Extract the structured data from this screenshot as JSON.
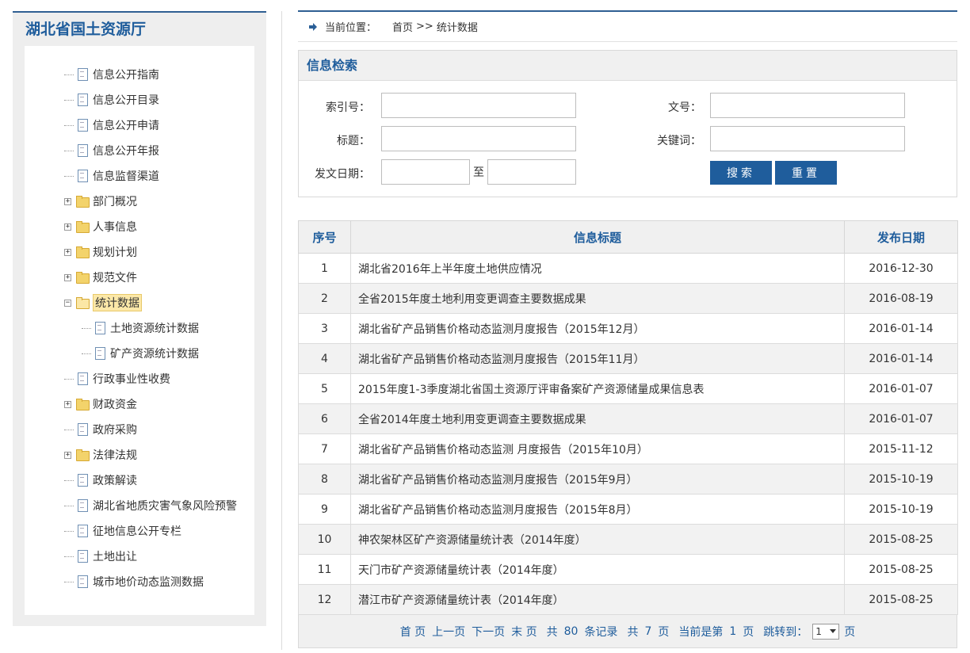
{
  "sidebar": {
    "title": "湖北省国土资源厅",
    "items": [
      {
        "label": "信息公开指南",
        "type": "doc"
      },
      {
        "label": "信息公开目录",
        "type": "doc"
      },
      {
        "label": "信息公开申请",
        "type": "doc"
      },
      {
        "label": "信息公开年报",
        "type": "doc"
      },
      {
        "label": "信息监督渠道",
        "type": "doc"
      },
      {
        "label": "部门概况",
        "type": "folder",
        "toggle": "+"
      },
      {
        "label": "人事信息",
        "type": "folder",
        "toggle": "+"
      },
      {
        "label": "规划计划",
        "type": "folder",
        "toggle": "+"
      },
      {
        "label": "规范文件",
        "type": "folder",
        "toggle": "+"
      },
      {
        "label": "统计数据",
        "type": "folder-open",
        "toggle": "−",
        "active": true
      },
      {
        "label": "土地资源统计数据",
        "type": "doc",
        "child": true
      },
      {
        "label": "矿产资源统计数据",
        "type": "doc",
        "child": true
      },
      {
        "label": "行政事业性收费",
        "type": "doc"
      },
      {
        "label": "财政资金",
        "type": "folder",
        "toggle": "+"
      },
      {
        "label": "政府采购",
        "type": "doc"
      },
      {
        "label": "法律法规",
        "type": "folder",
        "toggle": "+"
      },
      {
        "label": "政策解读",
        "type": "doc"
      },
      {
        "label": "湖北省地质灾害气象风险预警",
        "type": "doc"
      },
      {
        "label": "征地信息公开专栏",
        "type": "doc"
      },
      {
        "label": "土地出让",
        "type": "doc"
      },
      {
        "label": "城市地价动态监测数据",
        "type": "doc"
      }
    ]
  },
  "breadcrumb": {
    "label": "当前位置：",
    "home": "首页",
    "sep": ">>",
    "current": "统计数据"
  },
  "search": {
    "title": "信息检索",
    "index_label": "索引号：",
    "doc_label": "文号：",
    "title_label": "标题：",
    "keyword_label": "关键词：",
    "date_label": "发文日期：",
    "to_label": "至",
    "search_button": "搜索",
    "reset_button": "重置"
  },
  "table": {
    "headers": [
      "序号",
      "信息标题",
      "发布日期"
    ],
    "rows": [
      {
        "num": "1",
        "title": "湖北省2016年上半年度土地供应情况",
        "date": "2016-12-30"
      },
      {
        "num": "2",
        "title": "全省2015年度土地利用变更调查主要数据成果",
        "date": "2016-08-19"
      },
      {
        "num": "3",
        "title": "湖北省矿产品销售价格动态监测月度报告（2015年12月）",
        "date": "2016-01-14"
      },
      {
        "num": "4",
        "title": "湖北省矿产品销售价格动态监测月度报告（2015年11月）",
        "date": "2016-01-14"
      },
      {
        "num": "5",
        "title": "2015年度1-3季度湖北省国土资源厅评审备案矿产资源储量成果信息表",
        "date": "2016-01-07"
      },
      {
        "num": "6",
        "title": "全省2014年度土地利用变更调查主要数据成果",
        "date": "2016-01-07"
      },
      {
        "num": "7",
        "title": "湖北省矿产品销售价格动态监测 月度报告（2015年10月）",
        "date": "2015-11-12"
      },
      {
        "num": "8",
        "title": "湖北省矿产品销售价格动态监测月度报告（2015年9月）",
        "date": "2015-10-19"
      },
      {
        "num": "9",
        "title": "湖北省矿产品销售价格动态监测月度报告（2015年8月）",
        "date": "2015-10-19"
      },
      {
        "num": "10",
        "title": "神农架林区矿产资源储量统计表（2014年度）",
        "date": "2015-08-25"
      },
      {
        "num": "11",
        "title": "天门市矿产资源储量统计表（2014年度）",
        "date": "2015-08-25"
      },
      {
        "num": "12",
        "title": "潜江市矿产资源储量统计表（2014年度）",
        "date": "2015-08-25"
      }
    ]
  },
  "pager": {
    "first": "首 页",
    "prev": "上一页",
    "next": "下一页",
    "last": "末 页",
    "total_prefix": "共",
    "total_records": "80",
    "records_suffix": "条记录",
    "pages_prefix": "共",
    "total_pages": "7",
    "pages_suffix": "页",
    "current_prefix": "当前是第",
    "current_page": "1",
    "current_suffix": "页",
    "jump_label": "跳转到：",
    "jump_value": "1",
    "jump_suffix": "页"
  },
  "colors": {
    "accent": "#1f5d9c",
    "header_bg": "#f0f0f0"
  }
}
